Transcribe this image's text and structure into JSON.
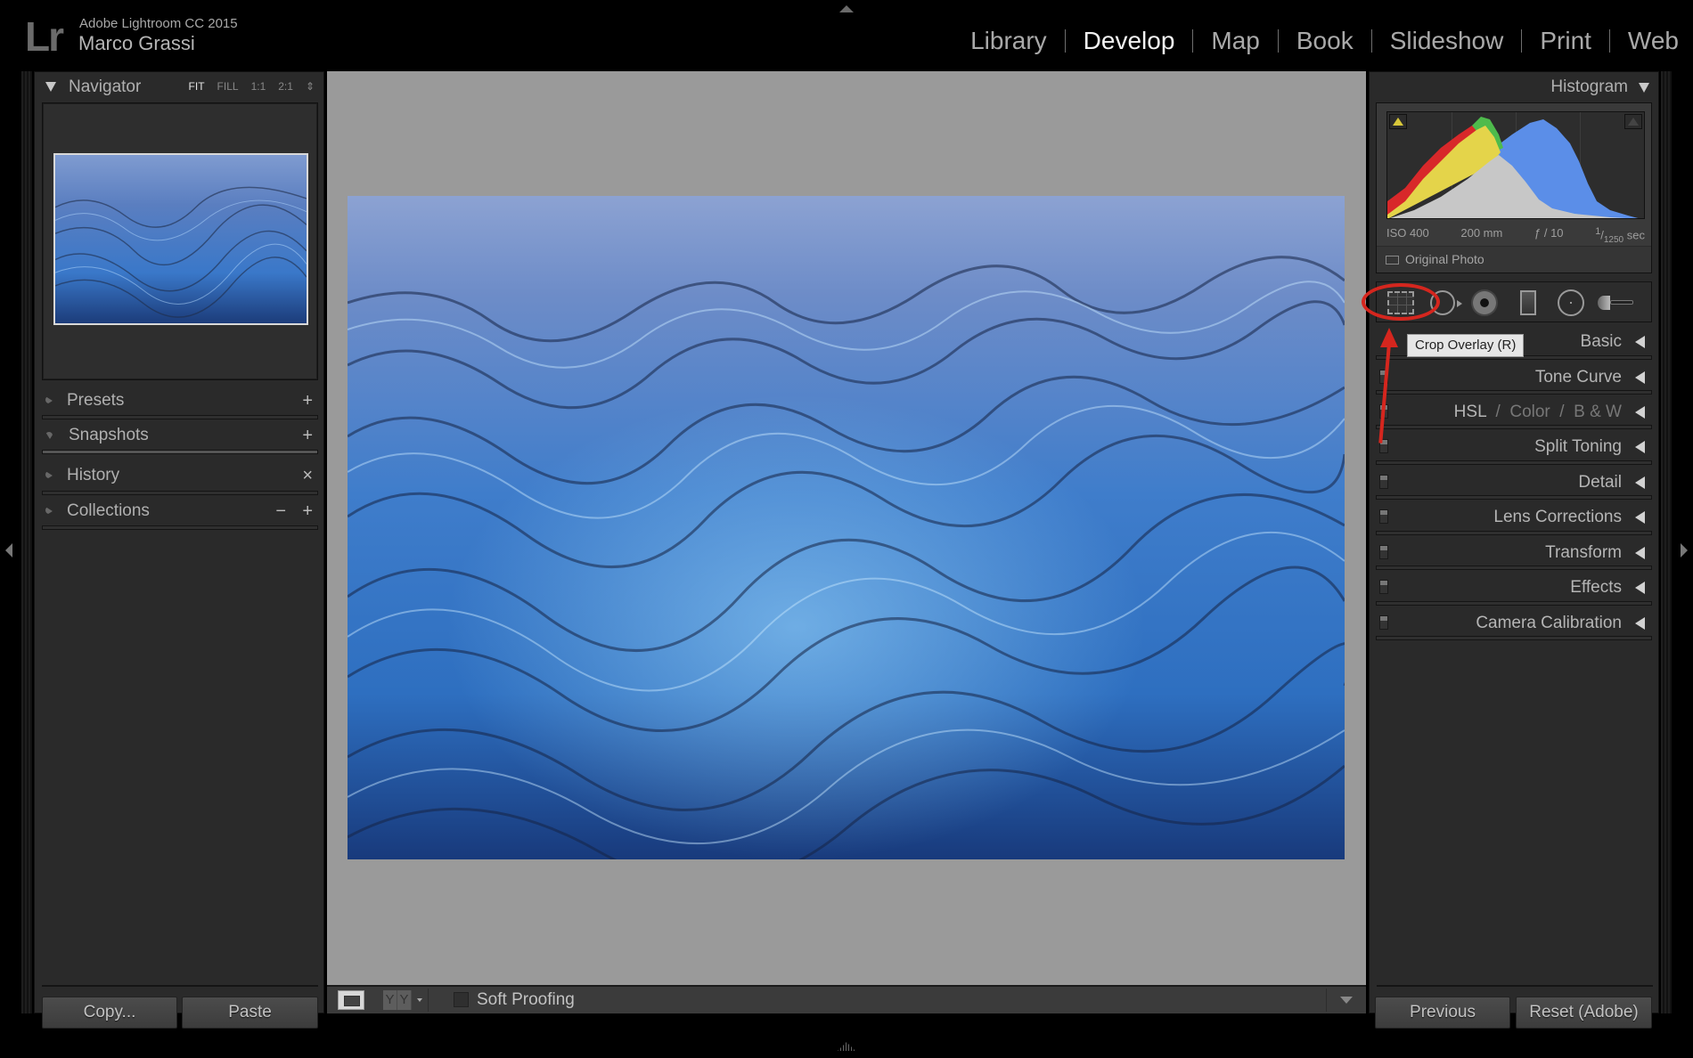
{
  "header": {
    "logo": "Lr",
    "app_name": "Adobe Lightroom CC 2015",
    "user_name": "Marco Grassi",
    "modules": [
      {
        "label": "Library",
        "active": false
      },
      {
        "label": "Develop",
        "active": true
      },
      {
        "label": "Map",
        "active": false
      },
      {
        "label": "Book",
        "active": false
      },
      {
        "label": "Slideshow",
        "active": false
      },
      {
        "label": "Print",
        "active": false
      },
      {
        "label": "Web",
        "active": false
      }
    ]
  },
  "left_panel": {
    "navigator": {
      "title": "Navigator",
      "zoom_options": [
        "FIT",
        "FILL",
        "1:1",
        "2:1"
      ],
      "active_zoom": "FIT"
    },
    "sections": [
      {
        "label": "Presets",
        "action": "+"
      },
      {
        "label": "Snapshots",
        "action": "+"
      },
      {
        "label": "History",
        "action": "×"
      },
      {
        "label": "Collections",
        "action": "+",
        "secondary_action": "−"
      }
    ],
    "buttons": {
      "copy": "Copy...",
      "paste": "Paste"
    }
  },
  "toolbar": {
    "yy_label_left": "Y",
    "yy_label_right": "Y",
    "soft_proofing_label": "Soft Proofing",
    "soft_proofing_checked": false
  },
  "right_panel": {
    "histogram": {
      "title": "Histogram",
      "iso": "ISO 400",
      "focal_length": "200 mm",
      "aperture": "ƒ / 10",
      "shutter_num": "1",
      "shutter_den": "1250",
      "shutter_unit": "sec",
      "original_photo_label": "Original Photo",
      "shadow_clip_color": "#d8c83a",
      "highlight_clip_color": "#444444"
    },
    "tools": [
      {
        "name": "Crop Overlay",
        "shortcut": "R"
      },
      {
        "name": "Spot Removal"
      },
      {
        "name": "Red Eye Correction"
      },
      {
        "name": "Graduated Filter"
      },
      {
        "name": "Radial Filter"
      },
      {
        "name": "Adjustment Brush"
      }
    ],
    "tooltip": "Crop Overlay (R)",
    "sections": [
      {
        "label": "Basic"
      },
      {
        "label": "Tone Curve"
      },
      {
        "label": "HSL",
        "extra": [
          "Color",
          "B & W"
        ]
      },
      {
        "label": "Split Toning"
      },
      {
        "label": "Detail"
      },
      {
        "label": "Lens Corrections"
      },
      {
        "label": "Transform"
      },
      {
        "label": "Effects"
      },
      {
        "label": "Camera Calibration"
      }
    ],
    "buttons": {
      "previous": "Previous",
      "reset": "Reset (Adobe)"
    }
  },
  "annotation": {
    "color": "#d5261e"
  }
}
